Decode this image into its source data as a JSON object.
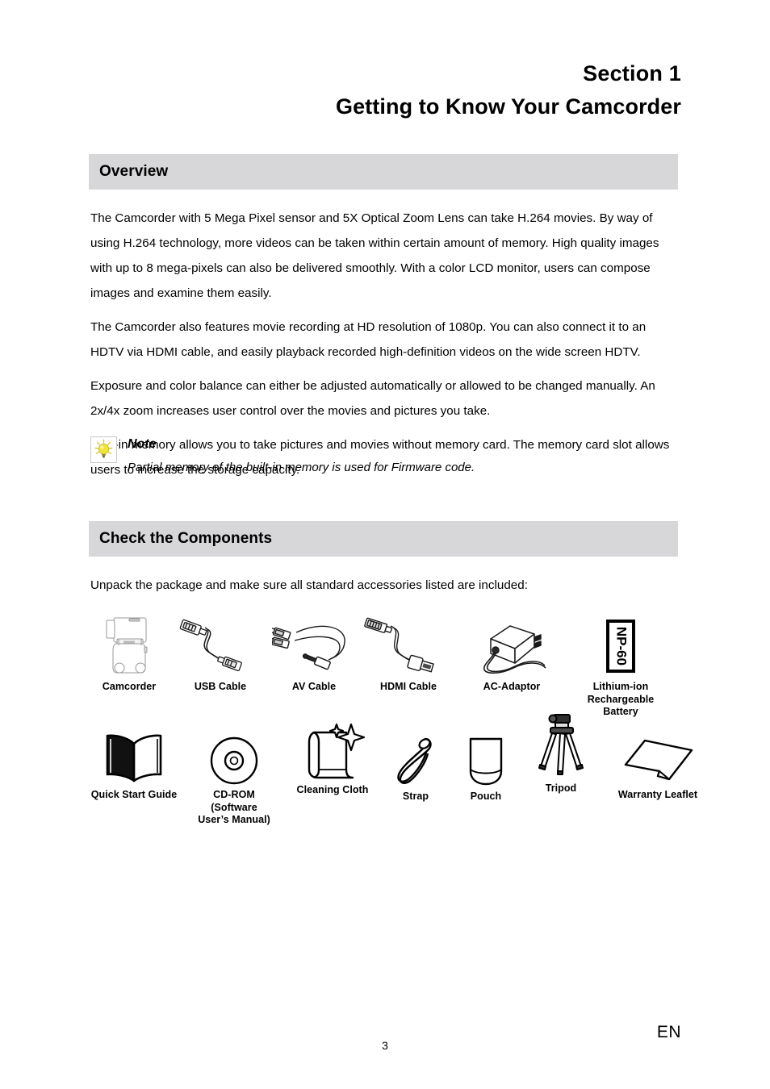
{
  "header": {
    "section_number": "Section 1",
    "section_title": "Getting to Know Your Camcorder"
  },
  "overview": {
    "heading": "Overview",
    "paragraphs": [
      "The Camcorder with 5 Mega Pixel sensor and 5X Optical Zoom Lens can take H.264 movies. By way of using H.264 technology, more videos can be taken within certain amount of memory. High quality images with up to 8 mega-pixels can also be delivered smoothly. With a color LCD monitor, users can compose images and examine them easily.",
      "The Camcorder also features movie recording at HD resolution of 1080p. You can also connect it to an HDTV via HDMI cable, and easily playback recorded high-definition videos on the wide screen HDTV.",
      "Exposure and color balance can either be adjusted automatically or allowed to be changed manually. An 2x/4x zoom increases user control over the movies and pictures you take.",
      "Built-in memory allows you to take pictures and movies without memory card. The memory card slot allows users to increase the storage capacity."
    ]
  },
  "note": {
    "icon": "lightbulb-icon",
    "title": "Note",
    "text": "Partial memory of the built-in memory is used for Firmware code."
  },
  "components": {
    "heading": "Check the Components",
    "intro": "Unpack the package and make sure all standard accessories listed are included:",
    "row1": [
      {
        "label": "Camcorder",
        "icon": "camcorder-icon"
      },
      {
        "label": "USB Cable",
        "icon": "usb-cable-icon"
      },
      {
        "label": "AV Cable",
        "icon": "av-cable-icon"
      },
      {
        "label": "HDMI Cable",
        "icon": "hdmi-cable-icon"
      },
      {
        "label": "AC-Adaptor",
        "icon": "ac-adaptor-icon"
      },
      {
        "label": "Lithium-ion\nRechargeable\nBattery",
        "icon": "battery-icon",
        "battery_model": "NP-60"
      }
    ],
    "row2": [
      {
        "label": "Quick Start Guide",
        "icon": "book-icon"
      },
      {
        "label": "CD-ROM\n(Software\nUser’s Manual)",
        "icon": "cd-rom-icon"
      },
      {
        "label": "Cleaning Cloth",
        "icon": "cleaning-cloth-icon"
      },
      {
        "label": "Strap",
        "icon": "strap-icon"
      },
      {
        "label": "Pouch",
        "icon": "pouch-icon"
      },
      {
        "label": "Tripod",
        "icon": "tripod-icon"
      },
      {
        "label": "Warranty Leaflet",
        "icon": "warranty-leaflet-icon"
      }
    ]
  },
  "footer": {
    "page_number": "3",
    "language": "EN"
  },
  "colors": {
    "band_background": "#d7d7d9",
    "text": "#000000",
    "bulb_yellow": "#f2e33a",
    "page_background": "#ffffff"
  }
}
